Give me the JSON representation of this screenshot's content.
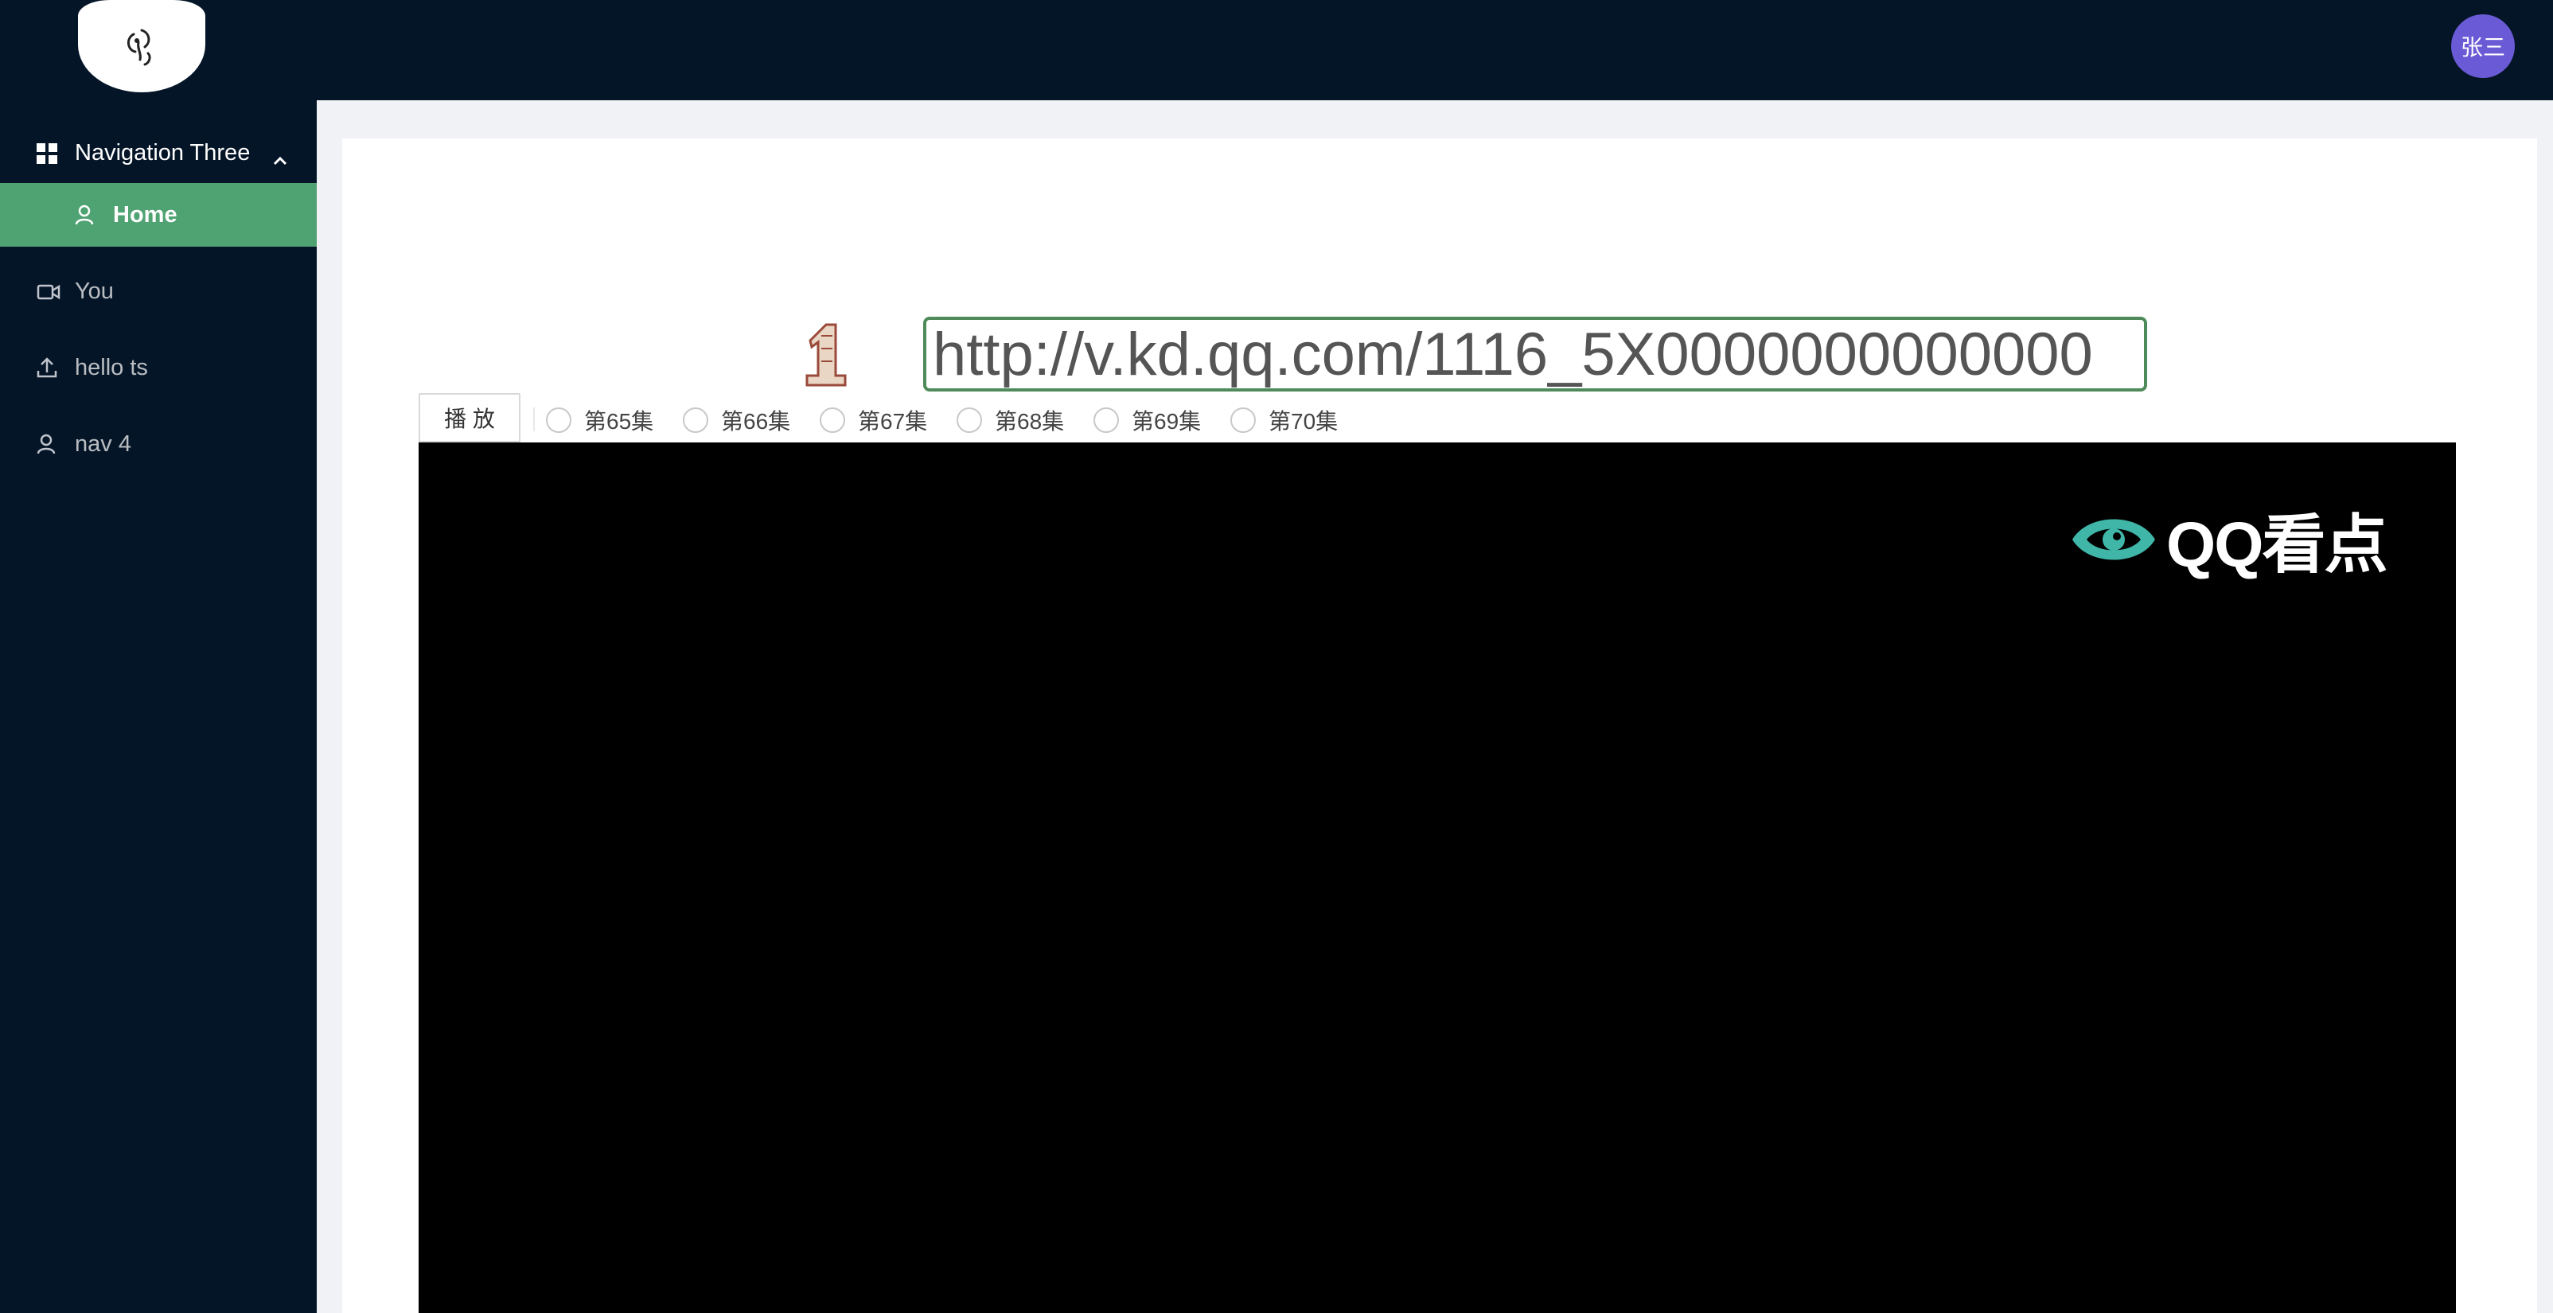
{
  "header": {
    "avatar_text": "张三"
  },
  "sidebar": {
    "submenu_title": "Navigation Three",
    "items": [
      {
        "label": "Home",
        "icon": "user-icon",
        "active": true
      },
      {
        "label": "You",
        "icon": "video-camera-icon",
        "active": false
      },
      {
        "label": "hello ts",
        "icon": "upload-icon",
        "active": false
      },
      {
        "label": "nav 4",
        "icon": "user-icon",
        "active": false
      }
    ]
  },
  "player": {
    "url_value": "http://v.kd.qq.com/1116_5X0000000000000",
    "play_label": "播 放",
    "episodes": [
      "第65集",
      "第66集",
      "第67集",
      "第68集",
      "第69集",
      "第70集"
    ],
    "watermark": "QQ看点"
  },
  "colors": {
    "header_bg": "#041527",
    "active_menu": "#4fa272",
    "avatar_bg": "#6b5ad6",
    "input_border": "#4f8a5a",
    "watermark_accent": "#3fb6a8"
  }
}
